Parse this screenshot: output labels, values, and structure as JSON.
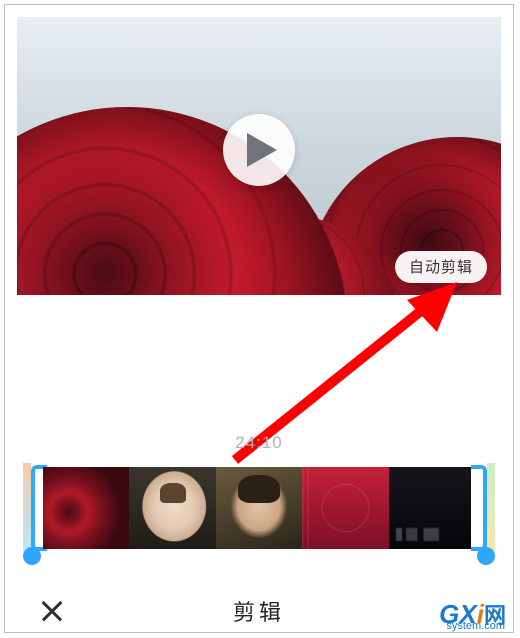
{
  "preview": {
    "auto_edit_label": "自动剪辑"
  },
  "timeline": {
    "timestamp": "24:10"
  },
  "bottom": {
    "title": "剪辑"
  },
  "watermark": {
    "g": "G",
    "x": "X",
    "i": "i",
    "cn": "网",
    "sub": "system.com"
  }
}
